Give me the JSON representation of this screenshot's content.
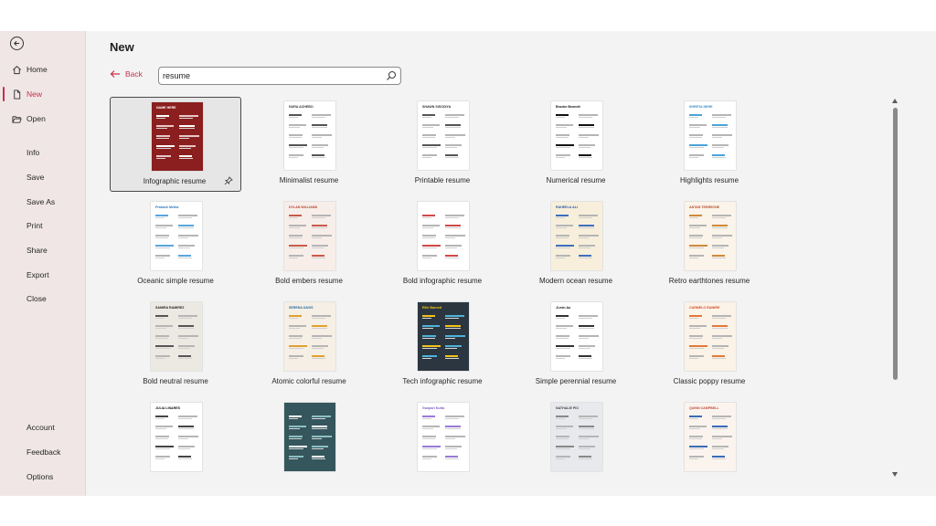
{
  "sidebar": {
    "back_icon": "back-arrow-icon",
    "items": [
      {
        "label": "Home",
        "icon": "home-icon",
        "active": false
      },
      {
        "label": "New",
        "icon": "new-document-icon",
        "active": true
      },
      {
        "label": "Open",
        "icon": "folder-open-icon",
        "active": false
      },
      {
        "label": "Info"
      },
      {
        "label": "Save"
      },
      {
        "label": "Save As"
      },
      {
        "label": "Print"
      },
      {
        "label": "Share"
      },
      {
        "label": "Export"
      },
      {
        "label": "Close"
      },
      {
        "label": "Account"
      },
      {
        "label": "Feedback"
      },
      {
        "label": "Options"
      }
    ]
  },
  "main": {
    "title": "New",
    "back_label": "Back",
    "search_value": "resume",
    "templates": [
      {
        "label": "Infographic resume",
        "thumb_name": "NAME HERE",
        "style": "red",
        "selected": true
      },
      {
        "label": "Minimalist resume",
        "thumb_name": "NURA ACHEBO",
        "style": "mono"
      },
      {
        "label": "Printable resume",
        "thumb_name": "SHAWN SISODIYA",
        "style": "mono"
      },
      {
        "label": "Numerical resume",
        "thumb_name": "Brooke Bennett",
        "style": "dark"
      },
      {
        "label": "Highlights resume",
        "thumb_name": "SHREYA NEHE",
        "style": "blue"
      },
      {
        "label": "Oceanic simple resume",
        "thumb_name": "Prakash Mehta",
        "style": "ocean"
      },
      {
        "label": "Bold embers resume",
        "thumb_name": "DYLAN WILLIAMS",
        "style": "ember"
      },
      {
        "label": "Bold infographic resume",
        "thumb_name": "",
        "style": "redinfo"
      },
      {
        "label": "Modern ocean resume",
        "thumb_name": "RAHEELA ALI",
        "style": "modernocean"
      },
      {
        "label": "Retro earthtones resume",
        "thumb_name": "ANTAN TEDRECHE",
        "style": "retro"
      },
      {
        "label": "Bold neutral resume",
        "thumb_name": "SAMIRA RAMIREZ",
        "style": "neutral"
      },
      {
        "label": "Atomic colorful resume",
        "thumb_name": "SERENA DAVIS",
        "style": "atomic"
      },
      {
        "label": "Tech infographic resume",
        "thumb_name": "Ellie Barnett",
        "style": "tech"
      },
      {
        "label": "Simple perennial resume",
        "thumb_name": "Ji-min Ao",
        "style": "perennial"
      },
      {
        "label": "Classic poppy resume",
        "thumb_name": "CARMELO RAMIRE",
        "style": "poppy"
      },
      {
        "label": "",
        "thumb_name": "JULIA LINARES",
        "style": "julia"
      },
      {
        "label": "",
        "thumb_name": "",
        "style": "teal"
      },
      {
        "label": "",
        "thumb_name": "Gunpari Kutra",
        "style": "purple"
      },
      {
        "label": "",
        "thumb_name": "NATHALIE PIO",
        "style": "gray"
      },
      {
        "label": "",
        "thumb_name": "QUINN CAMPBELL",
        "style": "quinn"
      }
    ]
  },
  "colors": {
    "accent": "#c4314b",
    "sidebar_bg": "#f0e6e6",
    "content_bg": "#f3f3f3"
  }
}
